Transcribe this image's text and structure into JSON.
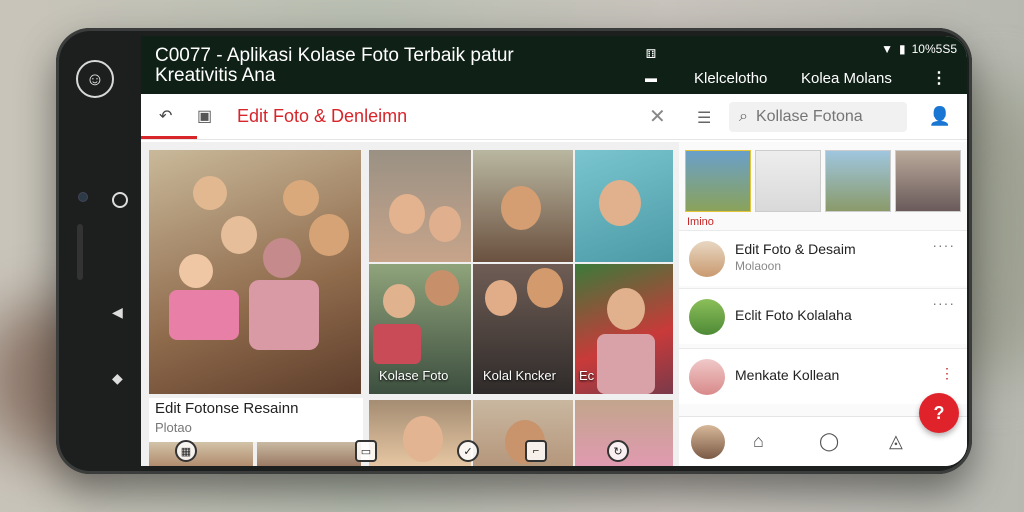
{
  "status": {
    "indicator": "⚅",
    "wifi": "▼",
    "battery": "▮",
    "time": "10%5S5",
    "sub": "▬"
  },
  "header": {
    "title": "C0077 - Aplikasi Kolase Foto Terbaik patur Kreativitis Ana",
    "nav": [
      "Klelcelotho",
      "Kolea Molans"
    ]
  },
  "toolbar": {
    "title": "Edit Foto & Denleimn"
  },
  "search": {
    "placeholder": "Kollase Fotona"
  },
  "grid": {
    "card_title": "Edit Fotonse Resainn",
    "card_sub": "Plotao",
    "captions": [
      "Kolase Foto",
      "Kolal Kncker",
      "Ec"
    ]
  },
  "right": {
    "section_label": "Imino",
    "rows": [
      {
        "title": "Edit Foto & Desaim",
        "sub": "Molaoon",
        "more": "····"
      },
      {
        "title": "Eclit Foto Kolalaha",
        "sub": "",
        "more": "····"
      },
      {
        "title": "Menkate Kollean",
        "sub": "",
        "more": "⋮"
      }
    ]
  },
  "fab": {
    "label": "?"
  },
  "colors": {
    "accent": "#d8252a",
    "topbar": "#0f2117"
  }
}
